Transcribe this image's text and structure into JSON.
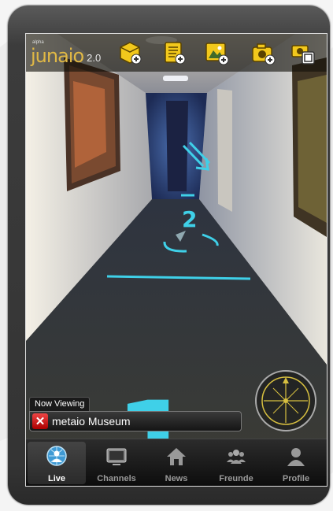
{
  "app": {
    "logo_prefix": "alpha",
    "logo_word": "junaio",
    "logo_version": "2.0"
  },
  "toolbar": {
    "buttons": [
      {
        "name": "add-object-button",
        "icon": "cube-plus-icon"
      },
      {
        "name": "add-note-button",
        "icon": "note-plus-icon"
      },
      {
        "name": "add-image-button",
        "icon": "image-plus-icon"
      },
      {
        "name": "add-photo-button",
        "icon": "camera-plus-icon"
      },
      {
        "name": "snapshot-button",
        "icon": "camera-copy-icon"
      }
    ]
  },
  "scene": {
    "marker_number_top": "2",
    "marker_number_bottom": "1"
  },
  "viewing": {
    "label": "Now Viewing",
    "title": "metaio Museum"
  },
  "tabs": [
    {
      "label": "Live",
      "icon": "globe-person-icon",
      "active": true
    },
    {
      "label": "Channels",
      "icon": "tv-icon",
      "active": false
    },
    {
      "label": "News",
      "icon": "house-icon",
      "active": false
    },
    {
      "label": "Freunde",
      "icon": "people-icon",
      "active": false
    },
    {
      "label": "Profile",
      "icon": "person-icon",
      "active": false
    }
  ],
  "colors": {
    "accent_yellow": "#e0b845",
    "ar_cyan": "#3fd0e8",
    "close_red": "#d22"
  }
}
